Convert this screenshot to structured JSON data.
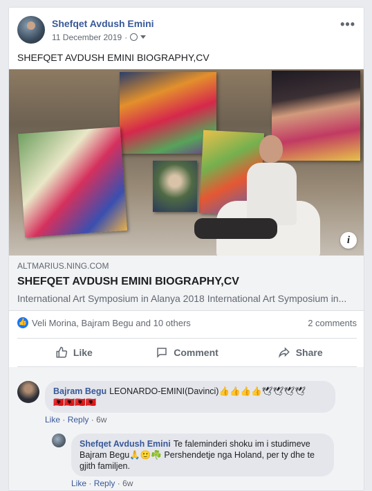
{
  "post": {
    "author": "Shefqet Avdush Emini",
    "date": "11 December 2019",
    "separator": "·",
    "text": "SHEFQET AVDUSH EMINI BIOGRAPHY,CV",
    "more": "•••"
  },
  "link_preview": {
    "domain": "ALTMARIUS.NING.COM",
    "title": "SHEFQET AVDUSH EMINI BIOGRAPHY,CV",
    "description": "International Art Symposium in Alanya 2018 International Art Symposium in...",
    "info_label": "i"
  },
  "stats": {
    "reactions": "Veli Morina, Bajram Begu and 10 others",
    "comments": "2 comments"
  },
  "actions": {
    "like": "Like",
    "comment": "Comment",
    "share": "Share"
  },
  "comments": [
    {
      "author": "Bajram Begu",
      "text": "LEONARDO-EMINI(Davinci)👍👍👍👍🕊🕊🕊🕊",
      "flags": "🇦🇱🇦🇱🇦🇱🇦🇱",
      "like": "Like",
      "reply": "Reply",
      "dot": "·",
      "time": "6w"
    },
    {
      "author": "Shefqet Avdush Emini",
      "text": "Te faleminderi shoku im i studimeve Bajram Begu🙏🙂☘️ Pershendetje nga Holand, per ty dhe te gjith familjen.",
      "like": "Like",
      "reply": "Reply",
      "dot": "·",
      "time": "6w"
    }
  ],
  "colors": {
    "link": "#385898",
    "accent": "#1877f2",
    "background": "#e9ebee"
  }
}
